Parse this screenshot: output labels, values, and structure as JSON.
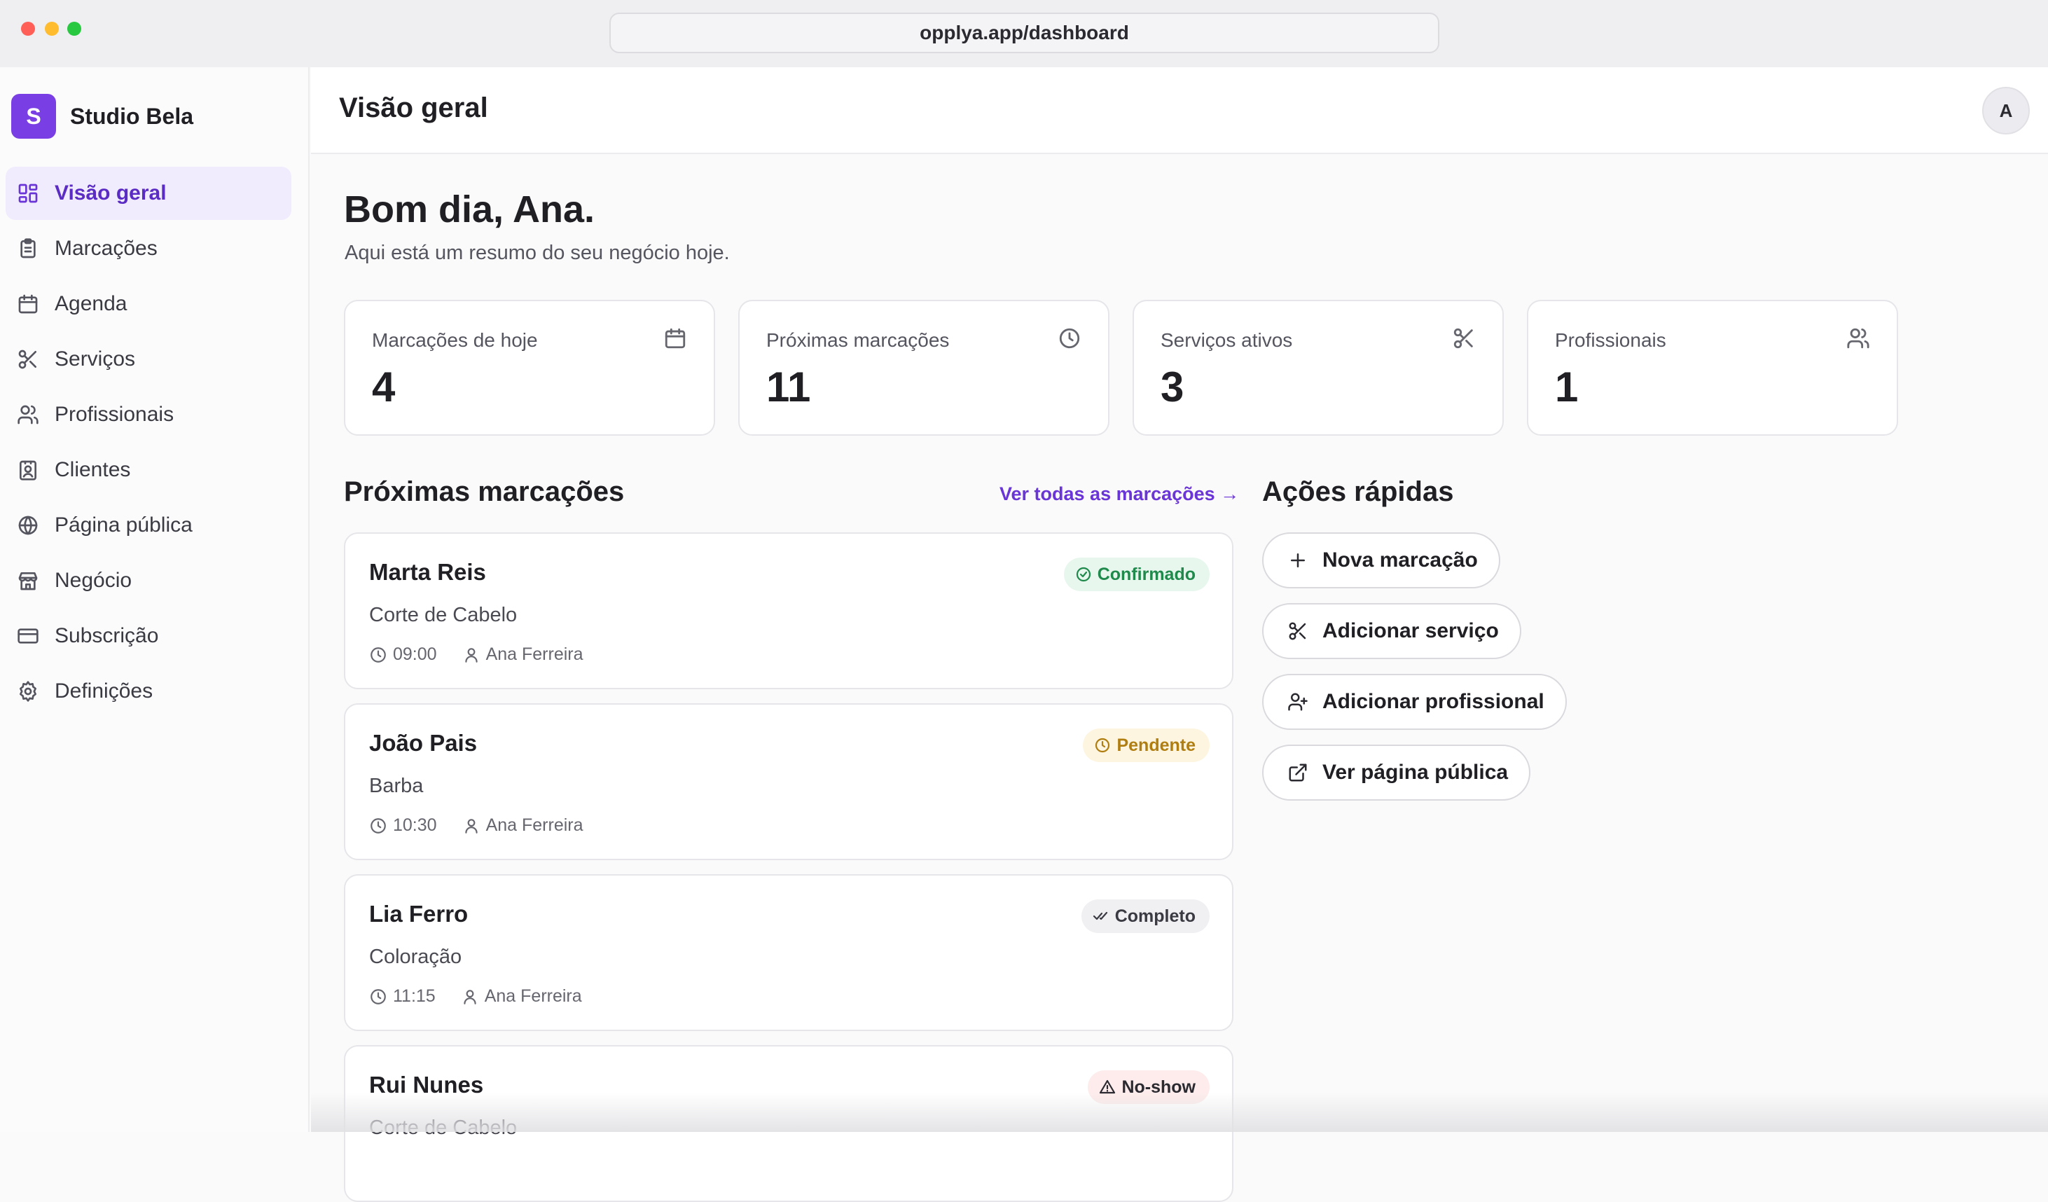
{
  "browser": {
    "url": "opplya.app/dashboard"
  },
  "brand": {
    "initial": "S",
    "name": "Studio Bela",
    "accent": "#7a3fe4"
  },
  "sidebar": {
    "items": [
      {
        "label": "Visão geral",
        "icon": "grid-icon",
        "active": true
      },
      {
        "label": "Marcações",
        "icon": "clipboard-icon"
      },
      {
        "label": "Agenda",
        "icon": "calendar-icon"
      },
      {
        "label": "Serviços",
        "icon": "scissors-icon"
      },
      {
        "label": "Profissionais",
        "icon": "users-icon"
      },
      {
        "label": "Clientes",
        "icon": "contact-icon"
      },
      {
        "label": "Página pública",
        "icon": "globe-icon"
      },
      {
        "label": "Negócio",
        "icon": "store-icon"
      },
      {
        "label": "Subscrição",
        "icon": "credit-card-icon"
      },
      {
        "label": "Definições",
        "icon": "gear-icon"
      }
    ]
  },
  "header": {
    "title": "Visão geral",
    "avatar_initial": "A"
  },
  "greeting": {
    "title": "Bom dia, Ana.",
    "subtitle": "Aqui está um resumo do seu negócio hoje."
  },
  "stats": [
    {
      "label": "Marcações de hoje",
      "value": "4",
      "icon": "calendar-icon"
    },
    {
      "label": "Próximas marcações",
      "value": "11",
      "icon": "clock-icon"
    },
    {
      "label": "Serviços ativos",
      "value": "3",
      "icon": "scissors-icon"
    },
    {
      "label": "Profissionais",
      "value": "1",
      "icon": "users-icon"
    }
  ],
  "appointments": {
    "title": "Próximas marcações",
    "see_all": "Ver todas as marcações →",
    "items": [
      {
        "name": "Marta Reis",
        "service": "Corte de Cabelo",
        "time": "09:00",
        "staff": "Ana Ferreira",
        "status": "Confirmado"
      },
      {
        "name": "João Pais",
        "service": "Barba",
        "time": "10:30",
        "staff": "Ana Ferreira",
        "status": "Pendente"
      },
      {
        "name": "Lia Ferro",
        "service": "Coloração",
        "time": "11:15",
        "staff": "Ana Ferreira",
        "status": "Completo"
      },
      {
        "name": "Rui Nunes",
        "service": "Corte de Cabelo",
        "time": "",
        "staff": "",
        "status": "No-show"
      }
    ]
  },
  "quick_actions": {
    "title": "Ações rápidas",
    "items": [
      {
        "label": "Nova marcação",
        "icon": "plus-icon"
      },
      {
        "label": "Adicionar serviço",
        "icon": "scissors-icon"
      },
      {
        "label": "Adicionar profissional",
        "icon": "user-plus-icon"
      },
      {
        "label": "Ver página pública",
        "icon": "external-link-icon"
      }
    ]
  }
}
